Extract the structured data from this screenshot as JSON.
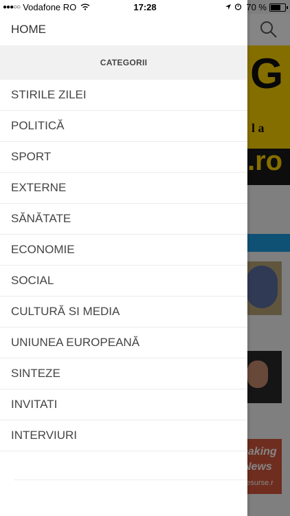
{
  "status_bar": {
    "carrier": "Vodafone RO",
    "time": "17:28",
    "battery": "70 %",
    "battery_level": 0.7
  },
  "drawer": {
    "home_label": "HOME",
    "section_title": "CATEGORII",
    "items": [
      {
        "label": "STIRILE ZILEI"
      },
      {
        "label": "POLITICĂ"
      },
      {
        "label": "SPORT"
      },
      {
        "label": "EXTERNE"
      },
      {
        "label": "SĂNĂTATE"
      },
      {
        "label": "ECONOMIE"
      },
      {
        "label": "SOCIAL"
      },
      {
        "label": "CULTURĂ SI MEDIA"
      },
      {
        "label": "UNIUNEA EUROPEANĂ"
      },
      {
        "label": "SINTEZE"
      },
      {
        "label": "INVITATI"
      },
      {
        "label": "INTERVIURI"
      }
    ]
  },
  "background": {
    "banner_big": "G",
    "banner_mid": "l a",
    "banner_bottom": ".ro",
    "card3_line1": "eaking",
    "card3_line2": "News",
    "card3_line3": "pesurse.r"
  },
  "colors": {
    "banner_yellow": "#ffd400",
    "strip_blue": "#1e9be0"
  }
}
